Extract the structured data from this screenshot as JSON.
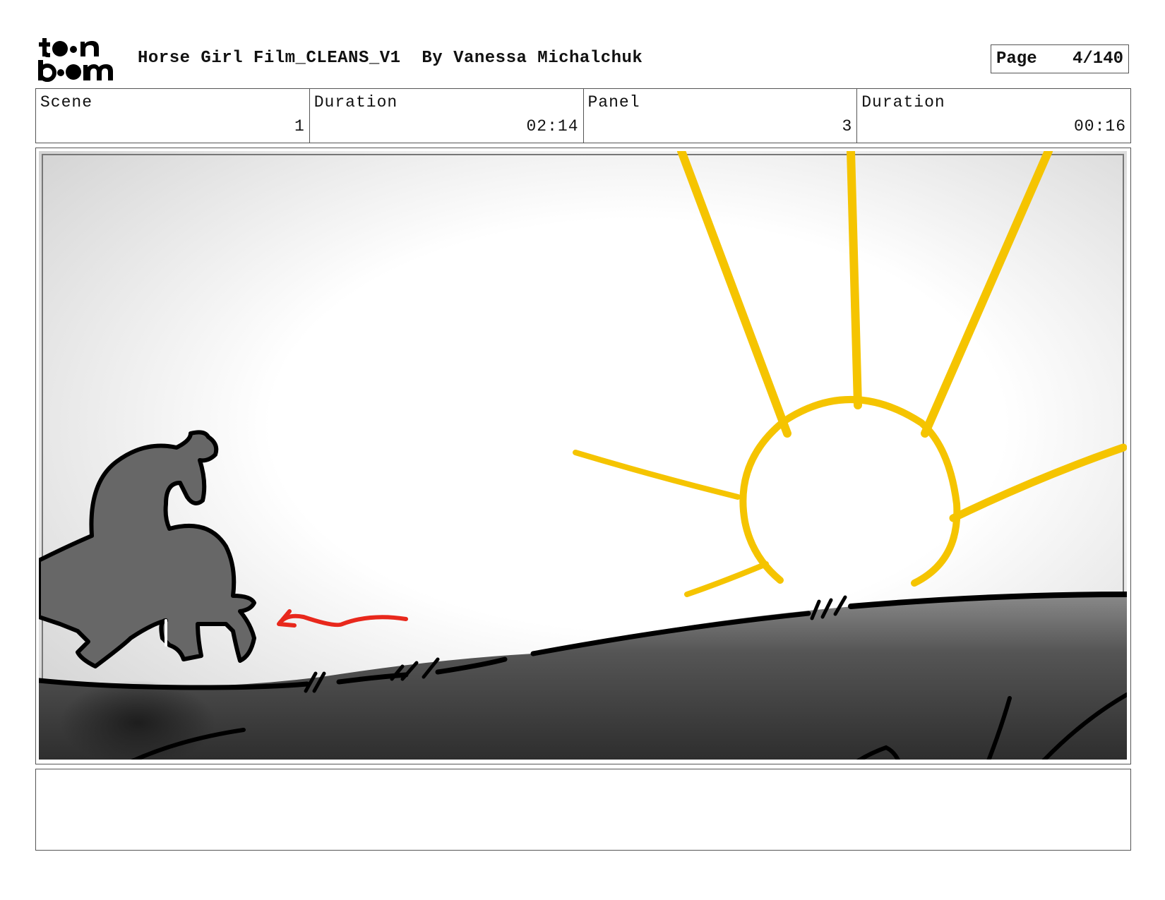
{
  "header": {
    "brand_logo": "toonboom-logo",
    "title": "Horse Girl Film_CLEANS_V1  By Vanessa Michalchuk",
    "page_label": "Page",
    "page_value": "4/140"
  },
  "info": {
    "scene_label": "Scene",
    "scene_value": "1",
    "duration_label": "Duration",
    "duration_value": "02:14",
    "panel_label": "Panel",
    "panel_value": "3",
    "panel_duration_label": "Duration",
    "panel_duration_value": "00:16"
  },
  "colors": {
    "sun": "#f5c400",
    "arrow": "#e8281c",
    "ground": "#3a3a3a",
    "creature": "#666666"
  },
  "notes": {
    "text": ""
  }
}
